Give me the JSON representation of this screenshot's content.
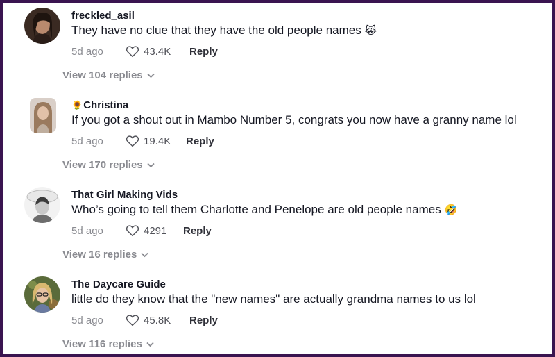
{
  "comments": [
    {
      "username": "freckled_asil",
      "text": "They have no clue that they have the old people names",
      "emoji": "😹",
      "time": "5d ago",
      "likes": "43.4K",
      "reply_label": "Reply",
      "view_replies": "View 104 replies",
      "avatar_icon": "avatar-woman-dark-hair"
    },
    {
      "username_prefix": "🌻",
      "username": "Christina",
      "text": "If you got a shout out in Mambo Number 5, congrats you now have a granny name lol",
      "time": "5d ago",
      "likes": "19.4K",
      "reply_label": "Reply",
      "view_replies": "View 170 replies",
      "avatar_icon": "avatar-woman-long-hair"
    },
    {
      "username": "That Girl Making Vids",
      "text": "Who’s going to tell them Charlotte and Penelope are old people names",
      "emoji": "🤣",
      "time": "5d ago",
      "likes": "4291",
      "reply_label": "Reply",
      "view_replies": "View 16 replies",
      "avatar_icon": "avatar-woman-hat-bw"
    },
    {
      "username": "The Daycare Guide",
      "text": "little do they know that the \"new names\" are actually grandma names to us lol",
      "time": "5d ago",
      "likes": "45.8K",
      "reply_label": "Reply",
      "view_replies": "View 116 replies",
      "avatar_icon": "avatar-woman-blonde-glasses"
    }
  ],
  "colors": {
    "frame_border": "#3a1450",
    "primary_text": "#161823",
    "secondary_text": "#8a8b91"
  }
}
